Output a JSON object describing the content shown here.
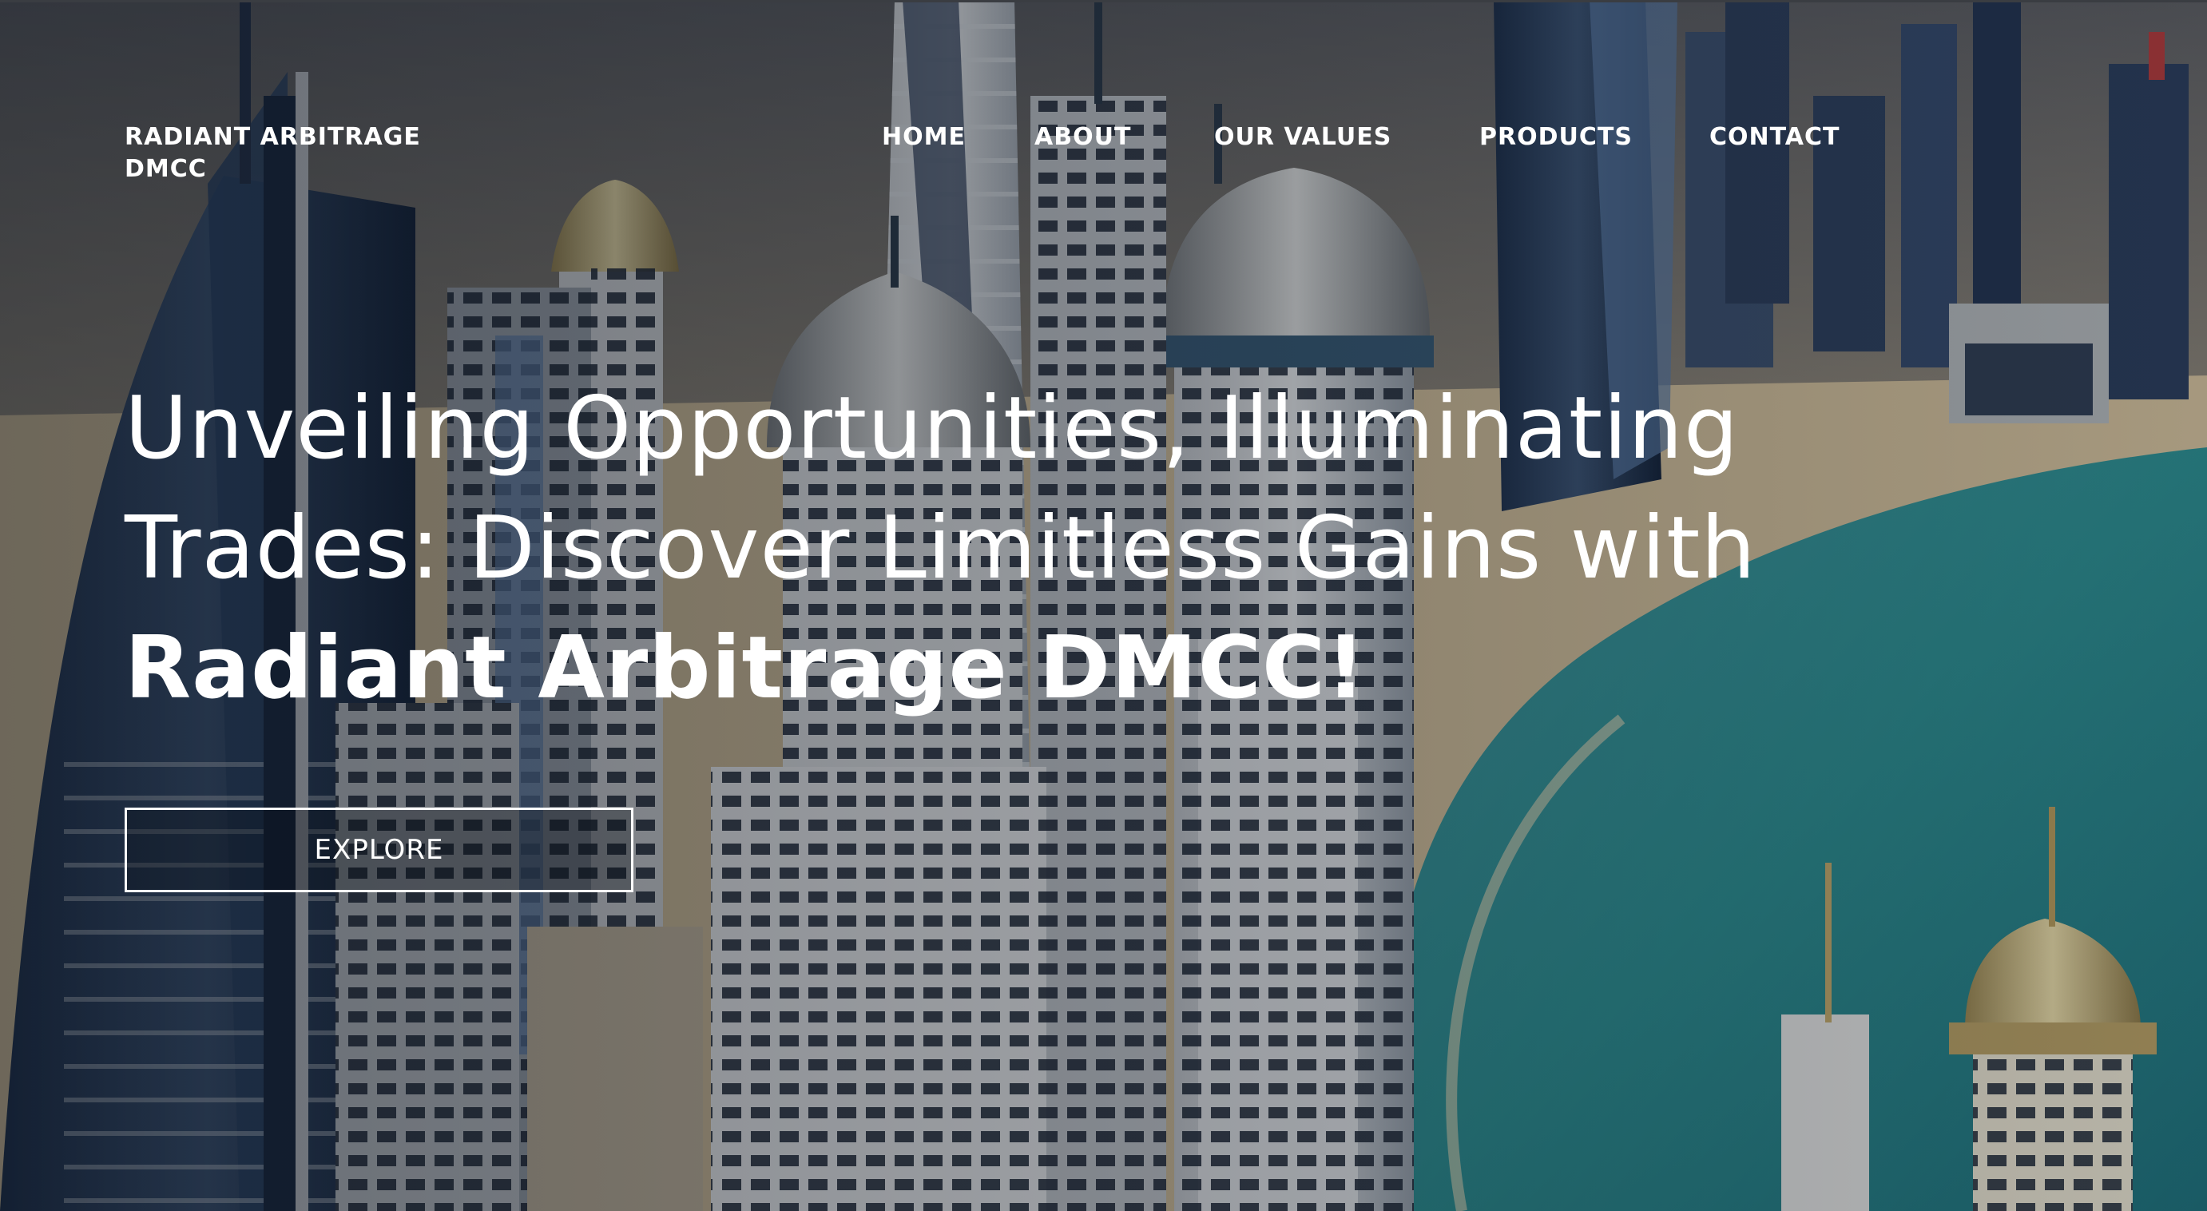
{
  "header": {
    "brand": "RADIANT ARBITRAGE DMCC",
    "nav": {
      "home": "HOME",
      "about": "ABOUT",
      "values": "OUR VALUES",
      "products": "PRODUCTS",
      "contact": "CONTACT"
    }
  },
  "hero": {
    "headline_line1": "Unveiling Opportunities, Illuminating",
    "headline_line2": "Trades: Discover Limitless Gains with",
    "headline_line3": "Radiant Arbitrage DMCC!",
    "cta_label": "EXPLORE"
  },
  "colors": {
    "text": "#ffffff",
    "sea": "#2f8f94",
    "sky": "#8b8478",
    "sand": "#d8c6a0"
  }
}
